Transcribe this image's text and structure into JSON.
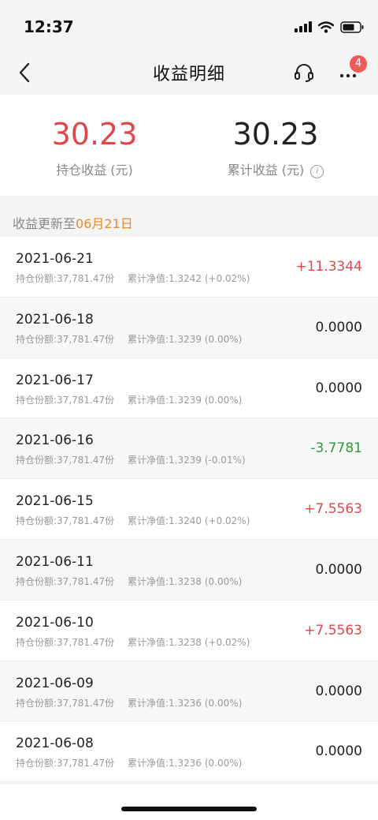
{
  "status_bar": {
    "time": "12:37"
  },
  "nav": {
    "title": "收益明细",
    "badge_count": "4"
  },
  "summary": {
    "holding": {
      "value": "30.23",
      "label": "持仓收益 (元)",
      "color": "#e0474c"
    },
    "cumulative": {
      "value": "30.23",
      "label": "累计收益 (元)",
      "color": "#222222"
    }
  },
  "update": {
    "prefix": "收益更新至",
    "date": "06月21日"
  },
  "colors": {
    "positive": "#e0474c",
    "negative": "#2f9b3e",
    "neutral": "#222222"
  },
  "records": [
    {
      "date": "2021-06-21",
      "holding": "持仓份额:37,781.47份",
      "nav": "累计净值:1.3242 (+0.02%)",
      "amount": "+11.3344",
      "trend": "positive"
    },
    {
      "date": "2021-06-18",
      "holding": "持仓份额:37,781.47份",
      "nav": "累计净值:1.3239 (0.00%)",
      "amount": "0.0000",
      "trend": "neutral"
    },
    {
      "date": "2021-06-17",
      "holding": "持仓份额:37,781.47份",
      "nav": "累计净值:1.3239 (0.00%)",
      "amount": "0.0000",
      "trend": "neutral"
    },
    {
      "date": "2021-06-16",
      "holding": "持仓份额:37,781.47份",
      "nav": "累计净值:1.3239 (-0.01%)",
      "amount": "-3.7781",
      "trend": "negative"
    },
    {
      "date": "2021-06-15",
      "holding": "持仓份额:37,781.47份",
      "nav": "累计净值:1.3240 (+0.02%)",
      "amount": "+7.5563",
      "trend": "positive"
    },
    {
      "date": "2021-06-11",
      "holding": "持仓份额:37,781.47份",
      "nav": "累计净值:1.3238 (0.00%)",
      "amount": "0.0000",
      "trend": "neutral"
    },
    {
      "date": "2021-06-10",
      "holding": "持仓份额:37,781.47份",
      "nav": "累计净值:1.3238 (+0.02%)",
      "amount": "+7.5563",
      "trend": "positive"
    },
    {
      "date": "2021-06-09",
      "holding": "持仓份额:37,781.47份",
      "nav": "累计净值:1.3236 (0.00%)",
      "amount": "0.0000",
      "trend": "neutral"
    },
    {
      "date": "2021-06-08",
      "holding": "持仓份额:37,781.47份",
      "nav": "累计净值:1.3236 (0.00%)",
      "amount": "0.0000",
      "trend": "neutral"
    }
  ]
}
